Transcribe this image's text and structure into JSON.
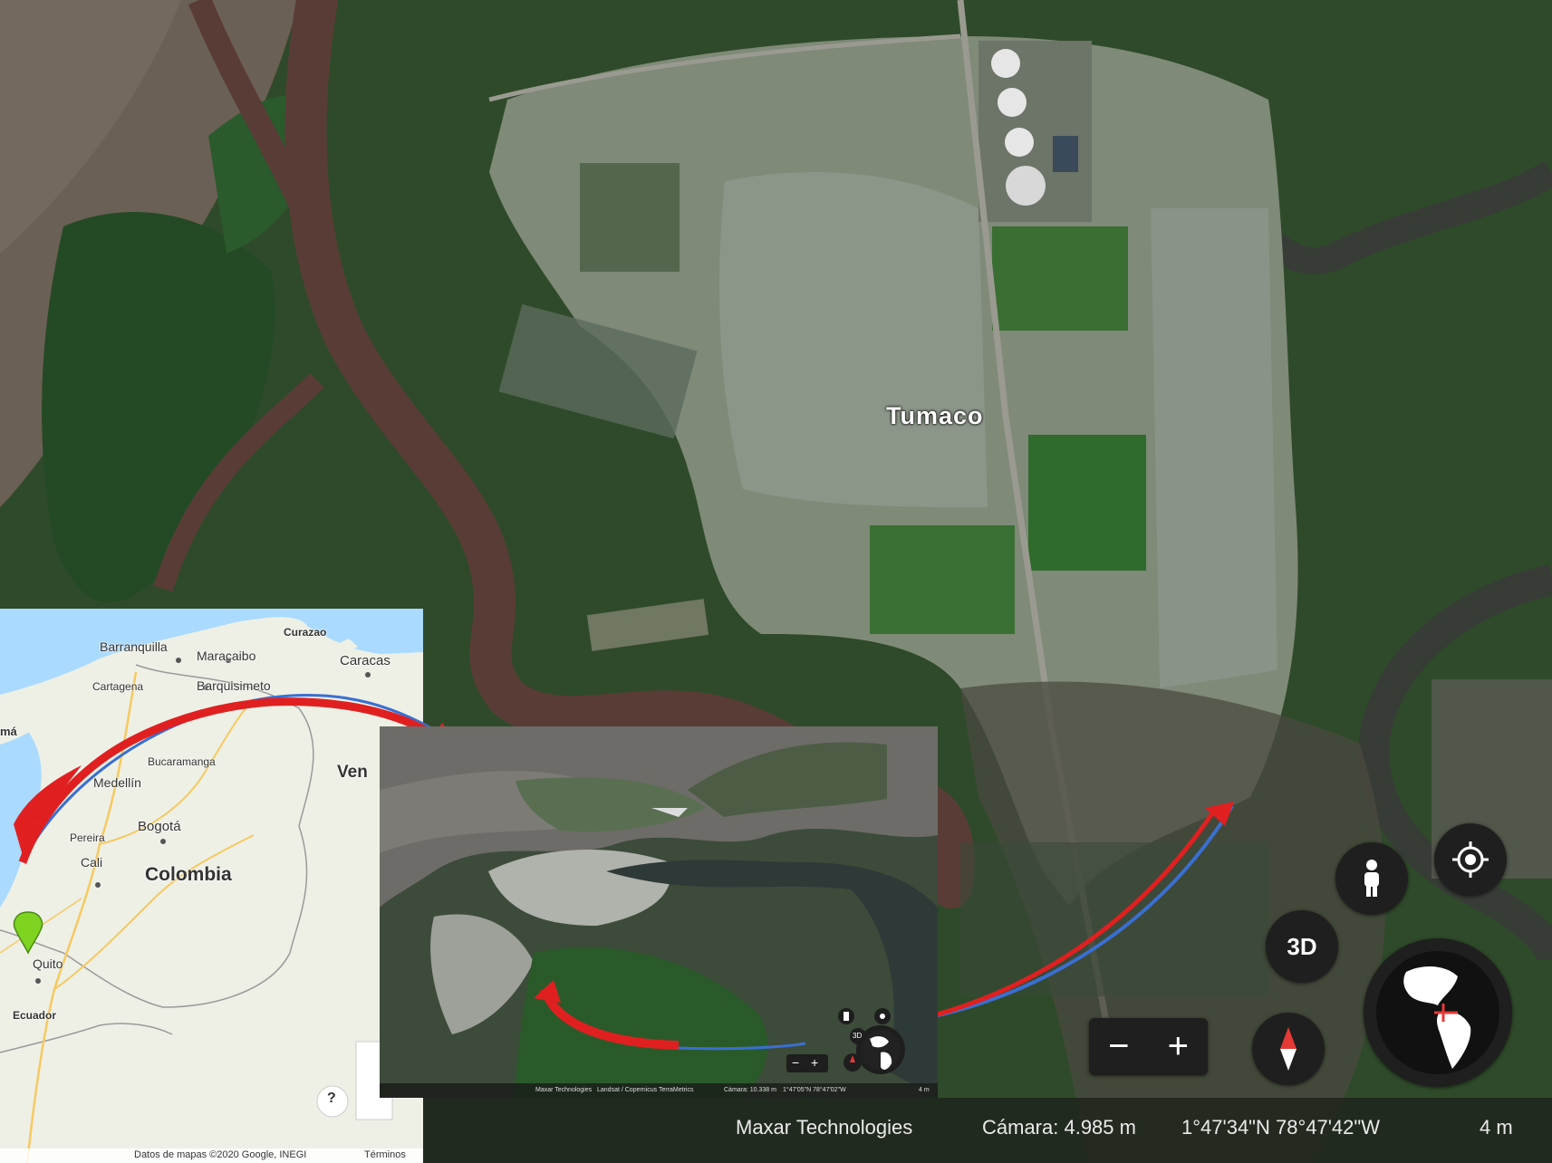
{
  "satellite": {
    "city_label": "Tumaco",
    "buttons": {
      "pegman_icon": "person-icon",
      "location_icon": "crosshair-icon",
      "three_d_label": "3D",
      "zoom_out_label": "−",
      "zoom_in_label": "+",
      "compass_icon": "compass-icon",
      "globe_icon": "globe-icon"
    },
    "attribution": {
      "provider": "Maxar Technologies",
      "camera": "Cámara: 4.985 m",
      "coordinates": "1°47'34\"N 78°47'42\"W",
      "scale": "4 m"
    }
  },
  "roadmap": {
    "labels": {
      "curazao": "Curazao",
      "barranquilla": "Barranquilla",
      "maracaibo": "Maracaibo",
      "caracas": "Caracas",
      "cartagena": "Cartagena",
      "barquisimeto": "Barquisimeto",
      "panama_fragment": "má",
      "bucaramanga": "Bucaramanga",
      "venezuela_fragment": "Ven",
      "medellin": "Medellín",
      "bogota": "Bogotá",
      "pereira": "Pereira",
      "cali": "Cali",
      "colombia": "Colombia",
      "quito": "Quito",
      "ecuador": "Ecuador"
    },
    "help_label": "?",
    "footer": {
      "data": "Datos de mapas ©2020 Google, INEGI",
      "terms": "Términos"
    }
  },
  "inset": {
    "attribution": {
      "provider": "Maxar Technologies",
      "sources": "Landsat / Copernicus  TerraMetrics",
      "camera": "Cámara: 10.338 m",
      "coordinates": "1°47'05\"N 78°47'02\"W",
      "scale": "4 m"
    },
    "three_d_label": "3D",
    "zoom_out_label": "−",
    "zoom_in_label": "+"
  },
  "colors": {
    "arrow_red": "#e02020",
    "arrow_blue": "#3a6fd1",
    "marker_green": "#7ed321",
    "sea": "#aadaff",
    "land": "#eef0e6"
  }
}
